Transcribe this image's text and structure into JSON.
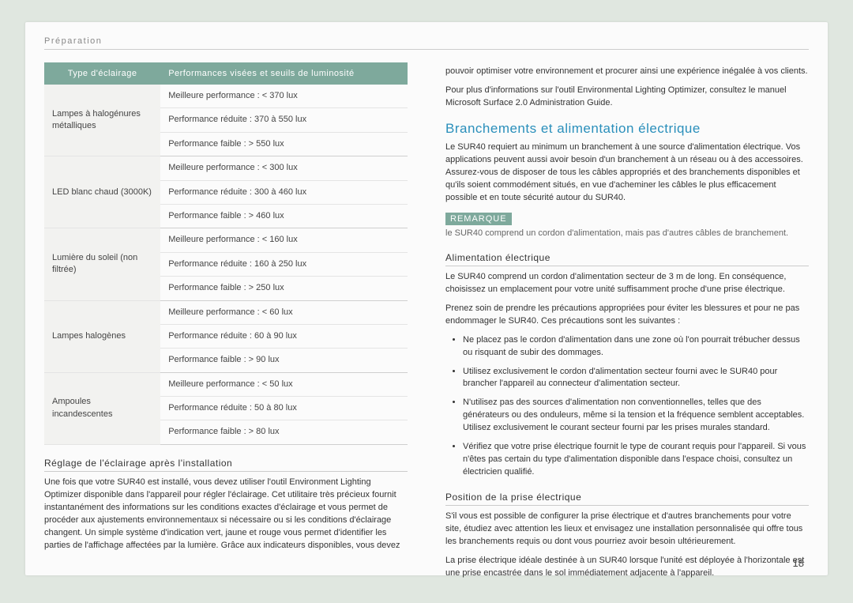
{
  "breadcrumb": "Préparation",
  "page_number": "18",
  "table": {
    "header_type": "Type d'éclairage",
    "header_perf": "Performances visées et seuils de luminosité",
    "rows": [
      {
        "type": "Lampes à halogénures métalliques",
        "lines": [
          "Meilleure performance : < 370 lux",
          "Performance réduite : 370 à 550 lux",
          "Performance faible : > 550 lux"
        ]
      },
      {
        "type": "LED blanc chaud (3000K)",
        "lines": [
          "Meilleure performance : < 300 lux",
          "Performance réduite : 300 à 460 lux",
          "Performance faible : > 460 lux"
        ]
      },
      {
        "type": "Lumière du soleil (non filtrée)",
        "lines": [
          "Meilleure performance : < 160 lux",
          "Performance réduite : 160 à 250 lux",
          "Performance faible : > 250 lux"
        ]
      },
      {
        "type": "Lampes halogènes",
        "lines": [
          "Meilleure performance : < 60 lux",
          "Performance réduite : 60 à 90 lux",
          "Performance faible : > 90 lux"
        ]
      },
      {
        "type": "Ampoules incandescentes",
        "lines": [
          "Meilleure performance : < 50 lux",
          "Performance réduite : 50 à 80 lux",
          "Performance faible : > 80 lux"
        ]
      }
    ]
  },
  "left": {
    "sub1": "Réglage de l'éclairage après l'installation",
    "para1": "Une fois que votre SUR40 est installé, vous devez utiliser l'outil Environment Lighting Optimizer disponible dans l'appareil pour régler l'éclairage. Cet utilitaire très précieux fournit instantanément des informations sur les conditions exactes d'éclairage et vous permet de procéder aux ajustements environnementaux si nécessaire ou si les conditions d'éclairage changent. Un simple système d'indication vert, jaune et rouge vous permet d'identifier les parties de l'affichage affectées par la lumière. Grâce aux indicateurs disponibles, vous devez"
  },
  "right": {
    "intro1": "pouvoir optimiser votre environnement et procurer ainsi une expérience inégalée à vos clients.",
    "intro2": "Pour plus d'informations sur l'outil Environmental Lighting Optimizer, consultez le manuel Microsoft Surface 2.0 Administration Guide.",
    "h2": "Branchements et alimentation électrique",
    "para_main": "Le SUR40 requiert au minimum un branchement à une source d'alimentation électrique. Vos applications peuvent aussi avoir besoin d'un branchement à un réseau ou à des accessoires. Assurez-vous de disposer de tous les câbles appropriés et des branchements disponibles et qu'ils soient commodément situés, en vue d'acheminer les câbles le plus efficacement possible et en toute sécurité autour du SUR40.",
    "note_label": "REMARQUE",
    "note_text": "le SUR40 comprend un cordon d'alimentation, mais pas d'autres câbles de branchement.",
    "sub_power": "Alimentation électrique",
    "power_p1": "Le SUR40 comprend un cordon d'alimentation secteur de 3 m de long. En conséquence, choisissez un emplacement pour votre unité suffisamment proche d'une prise électrique.",
    "power_p2": "Prenez soin de prendre les précautions appropriées pour éviter les blessures et pour ne pas endommager le SUR40. Ces précautions sont les suivantes :",
    "bullets": [
      "Ne placez pas le cordon d'alimentation dans une zone où l'on pourrait trébucher dessus ou risquant de subir des dommages.",
      "Utilisez exclusivement le cordon d'alimentation secteur fourni avec le SUR40 pour brancher l'appareil au connecteur d'alimentation secteur.",
      "N'utilisez pas des sources d'alimentation non conventionnelles, telles que des générateurs ou des onduleurs, même si la tension et la fréquence semblent acceptables. Utilisez exclusivement le courant secteur fourni par les prises murales standard.",
      "Vérifiez que votre prise électrique fournit le type de courant requis pour l'appareil. Si vous n'êtes pas certain du type d'alimentation disponible dans l'espace choisi, consultez un électricien qualifié."
    ],
    "sub_outlet": "Position de la prise électrique",
    "outlet_p1": "S'il vous est possible de configurer la prise électrique et d'autres branchements pour votre site, étudiez avec attention les lieux et envisagez une installation personnalisée qui offre tous les branchements requis ou dont vous pourriez avoir besoin ultérieurement.",
    "outlet_p2": "La prise électrique idéale destinée à un SUR40 lorsque l'unité est déployée à l'horizontale est une prise encastrée dans le sol immédiatement adjacente à l'appareil."
  }
}
